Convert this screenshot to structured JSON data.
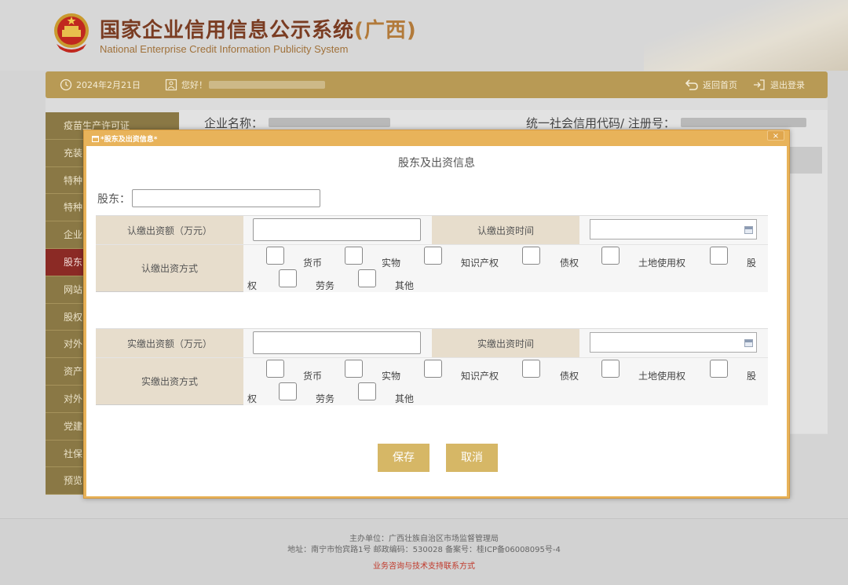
{
  "header": {
    "title_cn": "国家企业信用信息公示系统",
    "title_region": "(广西)",
    "title_en": "National Enterprise Credit Information Publicity System"
  },
  "topbar": {
    "date": "2024年2月21日",
    "greeting": "您好！",
    "home": "返回首页",
    "logout": "退出登录"
  },
  "company": {
    "name_label": "企业名称：",
    "credit_label": "统一社会信用代码/ 注册号："
  },
  "sidebar": {
    "items": [
      {
        "label": "疫苗生产许可证"
      },
      {
        "label": "充装"
      },
      {
        "label": "特种"
      },
      {
        "label": "特种"
      },
      {
        "label": "企业"
      },
      {
        "label": "股东"
      },
      {
        "label": "网站"
      },
      {
        "label": "股权"
      },
      {
        "label": "对外"
      },
      {
        "label": "资产"
      },
      {
        "label": "对外"
      },
      {
        "label": "党建"
      },
      {
        "label": "社保"
      },
      {
        "label": "预览"
      }
    ]
  },
  "dialog": {
    "title": "*股东及出资信息*",
    "close": "×",
    "section_title": "股东及出资信息",
    "holder_label": "股东：",
    "subscribed": {
      "amount_label": "认缴出资额（万元）",
      "time_label": "认缴出资时间",
      "method_label": "认缴出资方式"
    },
    "paid": {
      "amount_label": "实缴出资额（万元）",
      "time_label": "实缴出资时间",
      "method_label": "实缴出资方式"
    },
    "methods": [
      "货币",
      "实物",
      "知识产权",
      "债权",
      "土地使用权",
      "股",
      "权",
      "劳务",
      "其他"
    ],
    "save": "保存",
    "cancel": "取消"
  },
  "footer": {
    "host": "主办单位：广西壮族自治区市场监督管理局",
    "address": "地址：南宁市怡宾路1号 邮政编码：530028   备案号：桂ICP备06008095号-4",
    "support": "业务咨询与技术支持联系方式"
  },
  "colors": {
    "gold": "#b89a55",
    "sidebar": "#8a7845",
    "sidebar_active": "#8b2a25",
    "dialog_frame": "#e8b35a",
    "label_bg": "#e7ddcc",
    "button": "#d6b766"
  }
}
